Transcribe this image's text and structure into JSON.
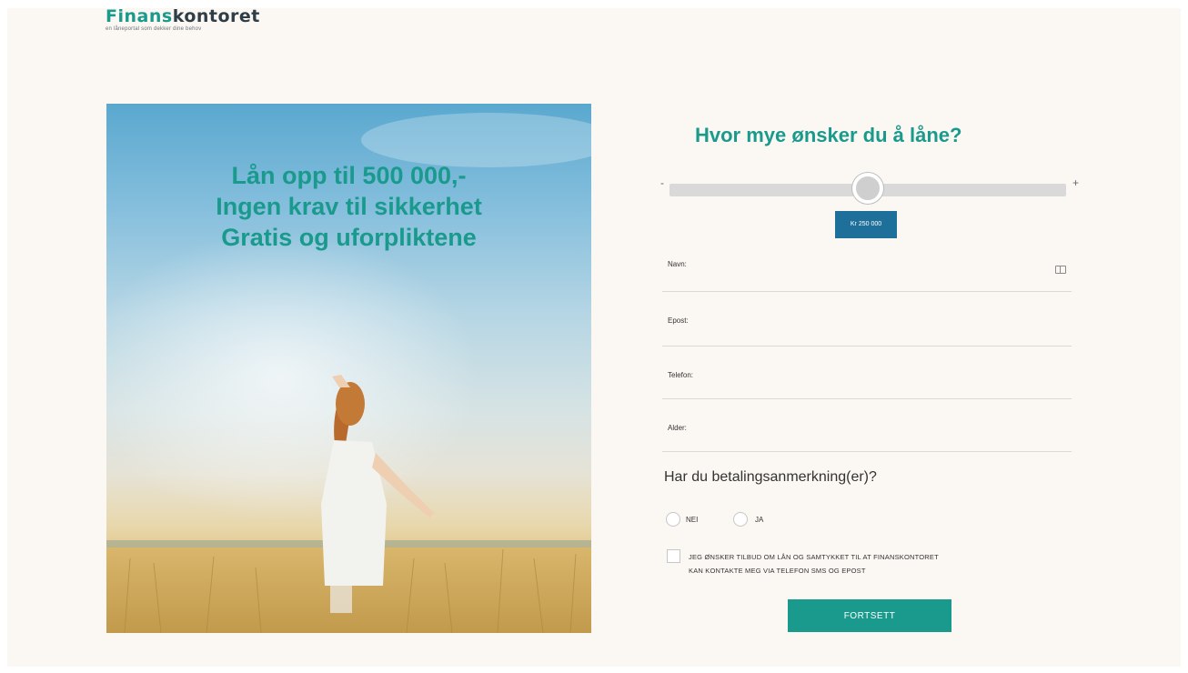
{
  "brand": {
    "name_part1": "Finans",
    "name_part2": "kontoret",
    "tagline": "en låneportal som dekker dine behov",
    "accent_color": "#1a9a8c",
    "dark_color": "#2f3d47"
  },
  "hero": {
    "lines": [
      "Lån opp til 500 000,-",
      "Ingen krav til sikkerhet",
      "Gratis og uforpliktene"
    ]
  },
  "loan": {
    "question": "Hvor mye ønsker du å låne?",
    "minus_label": "-",
    "plus_label": "+",
    "amount_label": "Kr 250 000",
    "slider_fraction": 0.5
  },
  "form": {
    "fields": [
      {
        "label": "Navn:",
        "value": ""
      },
      {
        "label": "Epost:",
        "value": ""
      },
      {
        "label": "Telefon:",
        "value": ""
      },
      {
        "label": "Alder:",
        "value": ""
      }
    ],
    "remark_question": "Har du betalingsanmerkning(er)?",
    "options": [
      "NEI",
      "JA"
    ],
    "consent_lines": [
      "JEG ØNSKER TILBUD OM LÅN OG SAMTYKKET TIL AT FINANSKONTORET",
      "KAN KONTAKTE MEG VIA TELEFON SMS OG EPOST"
    ],
    "submit_label": "FORTSETT"
  }
}
